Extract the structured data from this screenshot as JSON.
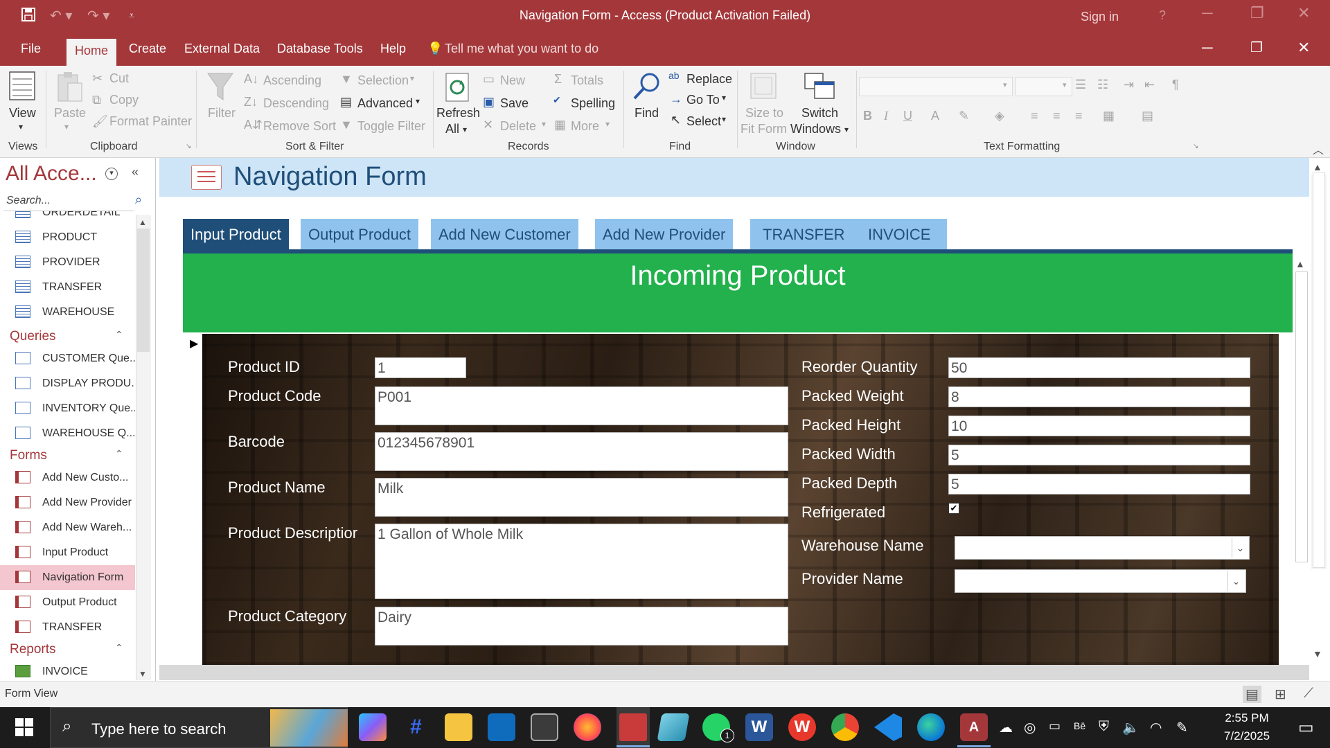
{
  "titlebar": {
    "title": "Navigation Form  -  Access (Product Activation Failed)",
    "sign_in": "Sign in",
    "help": "?"
  },
  "menu": {
    "items": [
      "File",
      "Home",
      "Create",
      "External Data",
      "Database Tools",
      "Help"
    ],
    "tell_me": "Tell me what you want to do"
  },
  "ribbon": {
    "views": {
      "view": "View",
      "group": "Views"
    },
    "clipboard": {
      "paste": "Paste",
      "cut": "Cut",
      "copy": "Copy",
      "format_painter": "Format Painter",
      "group": "Clipboard"
    },
    "sort_filter": {
      "filter": "Filter",
      "ascending": "Ascending",
      "descending": "Descending",
      "remove_sort": "Remove Sort",
      "selection": "Selection",
      "advanced": "Advanced",
      "toggle_filter": "Toggle Filter",
      "group": "Sort & Filter"
    },
    "records": {
      "refresh": "Refresh",
      "refresh2": "All",
      "new": "New",
      "save": "Save",
      "delete": "Delete",
      "totals": "Totals",
      "spelling": "Spelling",
      "more": "More",
      "group": "Records"
    },
    "find": {
      "find": "Find",
      "replace": "Replace",
      "goto": "Go To",
      "select": "Select",
      "group": "Find"
    },
    "window": {
      "size_to_fit": "Size to",
      "size_to_fit2": "Fit Form",
      "switch_windows": "Switch",
      "switch_windows2": "Windows",
      "group": "Window"
    },
    "text_formatting": {
      "group": "Text Formatting"
    }
  },
  "navpane": {
    "title": "All Acce...",
    "search_placeholder": "Search...",
    "tables": [
      "ORDERDETAIL",
      "PRODUCT",
      "PROVIDER",
      "TRANSFER",
      "WAREHOUSE"
    ],
    "queries_label": "Queries",
    "queries": [
      "CUSTOMER Que...",
      "DISPLAY PRODU...",
      "INVENTORY Que...",
      "WAREHOUSE Q..."
    ],
    "forms_label": "Forms",
    "forms": [
      "Add New Custo...",
      "Add New Provider",
      "Add New Wareh...",
      "Input Product",
      "Navigation Form",
      "Output Product",
      "TRANSFER"
    ],
    "reports_label": "Reports",
    "reports": [
      "INVOICE"
    ]
  },
  "form": {
    "header_title": "Navigation Form",
    "tabs": [
      "Input Product",
      "Output Product",
      "Add New Customer",
      "Add New Provider",
      "TRANSFER",
      "INVOICE"
    ],
    "banner": "Incoming Product",
    "fields_left": [
      {
        "label": "Product ID",
        "value": "1"
      },
      {
        "label": "Product Code",
        "value": "P001"
      },
      {
        "label": "Barcode",
        "value": "012345678901"
      },
      {
        "label": "Product Name",
        "value": "Milk"
      },
      {
        "label": "Product Descriptior",
        "value": "1 Gallon of Whole Milk"
      },
      {
        "label": "Product Category",
        "value": "Dairy"
      }
    ],
    "fields_right": [
      {
        "label": "Reorder Quantity",
        "value": "50"
      },
      {
        "label": "Packed Weight",
        "value": "8"
      },
      {
        "label": "Packed Height",
        "value": "10"
      },
      {
        "label": "Packed Width",
        "value": "5"
      },
      {
        "label": "Packed Depth",
        "value": "5"
      },
      {
        "label": "Refrigerated",
        "value": "✔"
      },
      {
        "label": "Warehouse Name",
        "value": ""
      },
      {
        "label": "Provider Name",
        "value": ""
      }
    ]
  },
  "status": {
    "text": "Form View"
  },
  "taskbar": {
    "search_placeholder": "Type here to search",
    "time": "2:55 PM",
    "date": "7/2/2025",
    "badge": "1"
  },
  "colors": {
    "access_red": "#a4373a",
    "tab_active": "#1f4e79",
    "tab_inactive": "#8fc3ee",
    "banner": "#22b14c",
    "header": "#cde5f7"
  }
}
